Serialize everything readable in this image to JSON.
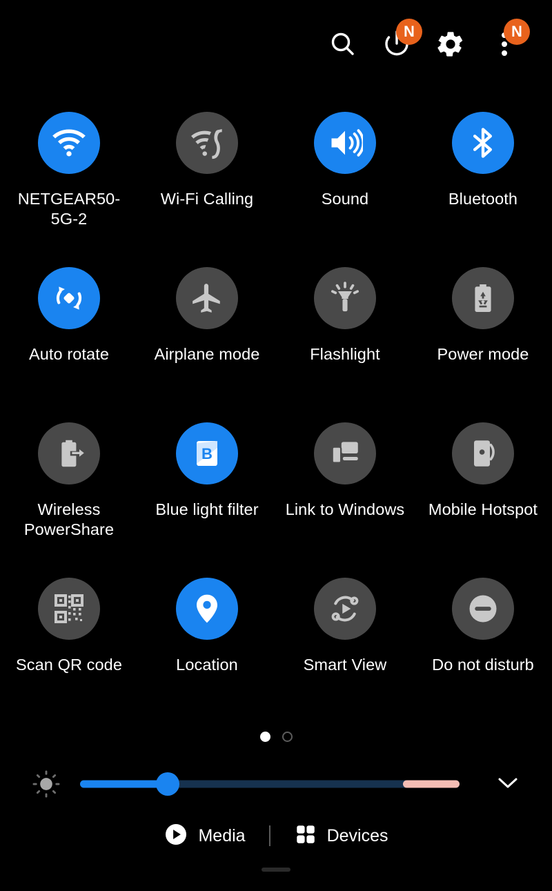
{
  "panel": {
    "title": "Quick settings panel",
    "background_color": "#000000",
    "active_color": "#1a84f0",
    "inactive_color": "#494949",
    "badge_color": "#e8621c"
  },
  "header": {
    "buttons": [
      {
        "name": "search-icon",
        "label": "Search",
        "badge": ""
      },
      {
        "name": "power-icon",
        "label": "Power off",
        "badge": "N"
      },
      {
        "name": "gear-icon",
        "label": "Settings",
        "badge": ""
      },
      {
        "name": "more-options-icon",
        "label": "More options",
        "badge": "N"
      }
    ],
    "badge_text": "N"
  },
  "tiles": [
    {
      "label": "NETGEAR50-5G-2",
      "icon": "wifi-icon",
      "state": "on"
    },
    {
      "label": "Wi-Fi Calling",
      "icon": "wifi-calling-icon",
      "state": "off"
    },
    {
      "label": "Sound",
      "icon": "sound-icon",
      "state": "on"
    },
    {
      "label": "Bluetooth",
      "icon": "bluetooth-icon",
      "state": "on"
    },
    {
      "label": "Auto rotate",
      "icon": "auto-rotate-icon",
      "state": "on"
    },
    {
      "label": "Airplane mode",
      "icon": "airplane-icon",
      "state": "off"
    },
    {
      "label": "Flashlight",
      "icon": "flashlight-icon",
      "state": "off"
    },
    {
      "label": "Power mode",
      "icon": "power-mode-icon",
      "state": "off"
    },
    {
      "label": "Wireless PowerShare",
      "icon": "wireless-powershare-icon",
      "state": "off"
    },
    {
      "label": "Blue light filter",
      "icon": "blue-light-filter-icon",
      "state": "on"
    },
    {
      "label": "Link to Windows",
      "icon": "link-to-windows-icon",
      "state": "off"
    },
    {
      "label": "Mobile Hotspot",
      "icon": "mobile-hotspot-icon",
      "state": "off"
    },
    {
      "label": "Scan QR code",
      "icon": "qr-code-icon",
      "state": "off"
    },
    {
      "label": "Location",
      "icon": "location-pin-icon",
      "state": "on"
    },
    {
      "label": "Smart View",
      "icon": "smart-view-icon",
      "state": "off"
    },
    {
      "label": "Do not disturb",
      "icon": "do-not-disturb-icon",
      "state": "off"
    }
  ],
  "pagination": {
    "total_pages": 2,
    "current_page": 1
  },
  "brightness": {
    "icon": "brightness-icon",
    "value_percent": 23,
    "warm_zone_start_percent": 85,
    "expand_icon": "chevron-down-icon",
    "fill_color": "#1a84f0",
    "track_color": "#16324f",
    "warm_color": "#f4bdb4"
  },
  "bottom_bar": {
    "media_label": "Media",
    "media_icon": "play-circle-icon",
    "devices_label": "Devices",
    "devices_icon": "grid-squares-icon"
  }
}
